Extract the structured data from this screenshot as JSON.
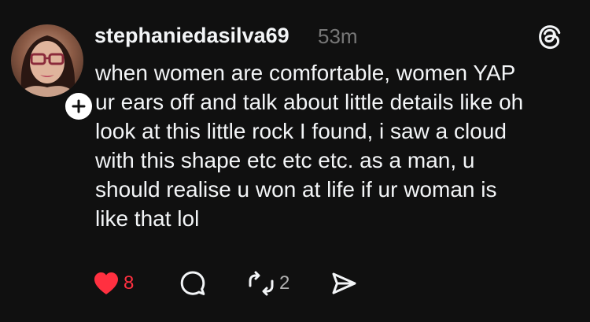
{
  "post": {
    "username": "stephaniedasilva69",
    "timestamp": "53m",
    "text": "when women are comfortable, women YAP\nur ears off and talk about little details like oh\nlook at this little rock I found, i saw a cloud\nwith this shape etc etc etc. as a man, u\nshould realise u won at life if ur woman is\nlike that lol"
  },
  "actions": {
    "likes": "8",
    "reposts": "2"
  },
  "icons": {
    "like": "heart-icon",
    "comment": "comment-bubble-icon",
    "repost": "repost-arrows-icon",
    "share": "send-icon",
    "app": "threads-logo-icon",
    "follow": "plus-icon"
  },
  "colors": {
    "background": "#101010",
    "text": "#f3f5f7",
    "muted": "#777777",
    "like": "#ff3040"
  }
}
